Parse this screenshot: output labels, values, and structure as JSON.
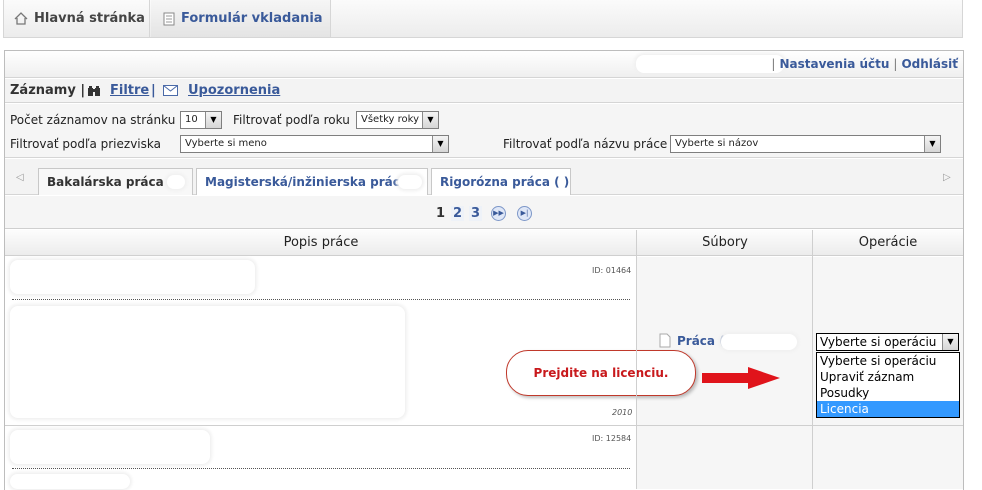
{
  "nav": {
    "home_label": "Hlavná stránka",
    "form_label": "Formulár vkladania"
  },
  "userbar": {
    "settings_label": "Nastavenia účtu",
    "separator": "|",
    "logout_label": "Odhlásiť"
  },
  "records": {
    "label": "Záznamy |",
    "filters_label": "Filtre",
    "pipe": "|",
    "alerts_label": "Upozornenia"
  },
  "filters": {
    "per_page_label": "Počet záznamov na stránku",
    "per_page_value": "10",
    "year_label": "Filtrovať podľa roku",
    "year_value": "Všetky roky",
    "surname_label": "Filtrovať podľa priezviska",
    "surname_value": "Vyberte si meno",
    "title_label": "Filtrovať podľa názvu práce",
    "title_value": "Vyberte si názov"
  },
  "tabs": [
    {
      "label": "Bakalárska práca ("
    },
    {
      "label": "Magisterská/inžinierska práca ("
    },
    {
      "label": "Rigorózna práca (  )"
    }
  ],
  "pager": {
    "pages": [
      "1",
      "2",
      "3"
    ],
    "next_icon": "next-page-icon",
    "last_icon": "last-page-icon"
  },
  "table": {
    "headers": [
      "Popis práce",
      "Súbory",
      "Operácie"
    ],
    "rows": [
      {
        "id": "ID: 01464",
        "year": "2010",
        "file_label": "Práca (",
        "operation": "Vyberte si operáciu"
      },
      {
        "id": "ID: 12584"
      }
    ]
  },
  "operations_dropdown": {
    "options": [
      "Vyberte si operáciu",
      "Upraviť záznam",
      "Posudky",
      "Licencia"
    ],
    "highlighted": "Licencia"
  },
  "callout": {
    "text": "Prejdite na licenciu."
  },
  "colors": {
    "link": "#3a5a9a",
    "callout_text": "#c8191c",
    "arrow": "#e0141b",
    "highlight": "#3399ff"
  }
}
